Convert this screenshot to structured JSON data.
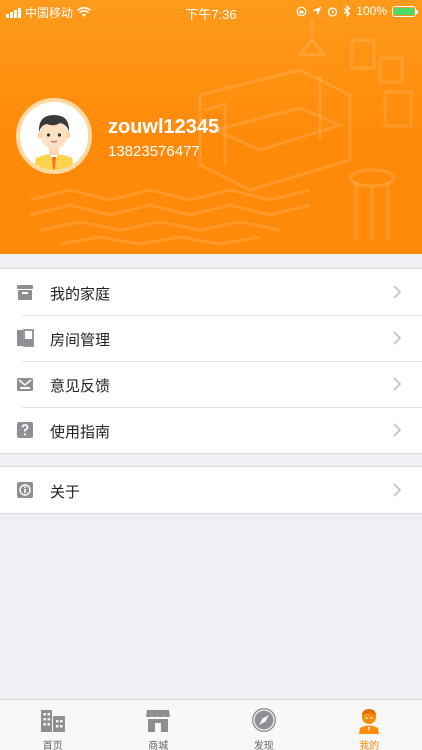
{
  "status_bar": {
    "carrier": "中国移动",
    "time": "下午7:36",
    "battery": "100%",
    "battery_level": 1.0
  },
  "profile": {
    "username": "zouwl12345",
    "phone": "13823576477"
  },
  "menu_group_1": [
    {
      "label": "我的家庭",
      "icon": "home-box-icon"
    },
    {
      "label": "房间管理",
      "icon": "room-icon"
    },
    {
      "label": "意见反馈",
      "icon": "feedback-icon"
    },
    {
      "label": "使用指南",
      "icon": "guide-icon"
    }
  ],
  "menu_group_2": [
    {
      "label": "关于",
      "icon": "info-icon"
    }
  ],
  "tabs": [
    {
      "label": "首页",
      "icon": "building-icon",
      "active": false
    },
    {
      "label": "商城",
      "icon": "store-icon",
      "active": false
    },
    {
      "label": "发现",
      "icon": "compass-icon",
      "active": false
    },
    {
      "label": "我的",
      "icon": "user-icon",
      "active": true
    }
  ],
  "colors": {
    "accent": "#ff8c0a",
    "icon_gray": "#8e8e93",
    "background": "#efeff4"
  }
}
